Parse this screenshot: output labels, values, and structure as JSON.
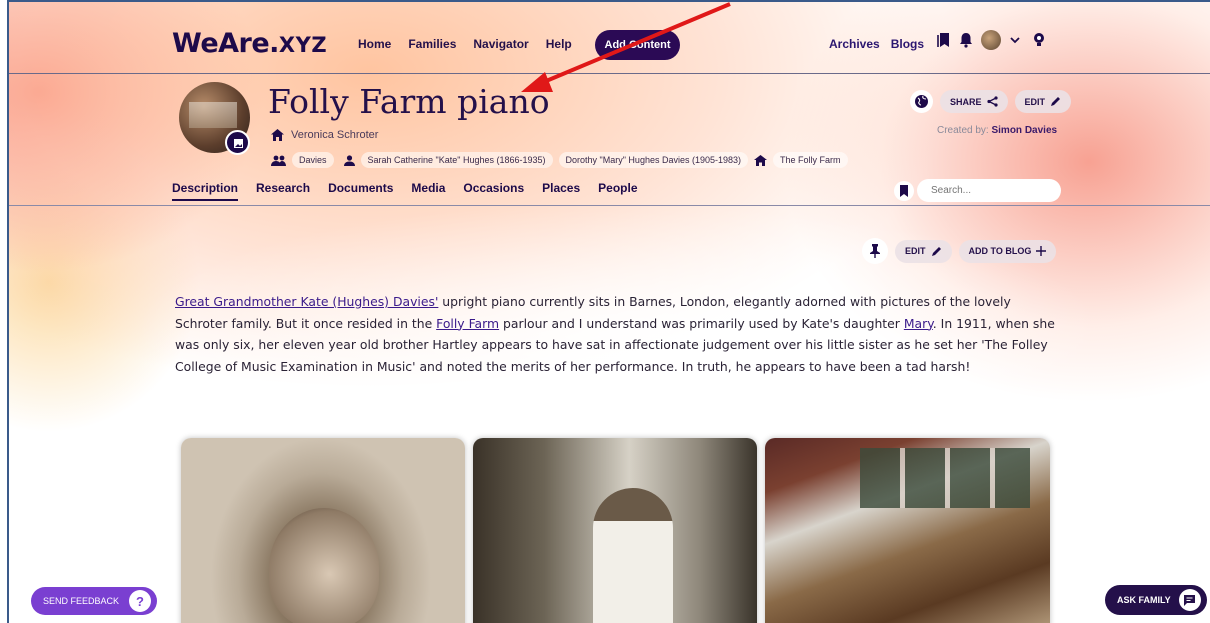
{
  "brand": {
    "logo_main": "WeAre.",
    "logo_small": "XYZ"
  },
  "nav": {
    "home": "Home",
    "families": "Families",
    "navigator": "Navigator",
    "help": "Help",
    "add_content": "Add Content",
    "archives": "Archives",
    "blogs": "Blogs"
  },
  "header": {
    "title": "Folly Farm piano",
    "owner": "Veronica Schroter",
    "tags": {
      "family": "Davies",
      "person1": "Sarah Catherine \"Kate\" Hughes (1866-1935)",
      "person2": "Dorothy \"Mary\" Hughes Davies (1905-1983)",
      "place": "The Folly Farm"
    },
    "share_label": "SHARE",
    "edit_label": "EDIT",
    "created_by_prefix": "Created by:",
    "created_by_name": "Simon Davies"
  },
  "tabs": [
    "Description",
    "Research",
    "Documents",
    "Media",
    "Occasions",
    "Places",
    "People"
  ],
  "search": {
    "placeholder": "Search..."
  },
  "content": {
    "edit_label": "EDIT",
    "add_to_blog_label": "ADD TO BLOG",
    "link1": "Great Grandmother Kate (Hughes) Davies'",
    "text1": " upright piano currently sits in Barnes, London, elegantly adorned with pictures of the lovely Schroter family. But it once resided in the ",
    "link2": "Folly Farm",
    "text2": " parlour and I understand was primarily used by Kate's daughter ",
    "link3": "Mary",
    "text3": ". In 1911, when she was only six, her eleven year old brother Hartley appears to have sat in affectionate judgement over his little sister as he set her 'The Folley College of Music Examination in Music' and noted the merits of her performance. In truth, he appears to have been a tad harsh!"
  },
  "floating": {
    "feedback": "SEND FEEDBACK",
    "ask_family": "ASK FAMILY"
  },
  "colors": {
    "brand_dark": "#1d0a4a",
    "feedback_purple": "#7a3fd1",
    "arrow_red": "#e01818"
  }
}
